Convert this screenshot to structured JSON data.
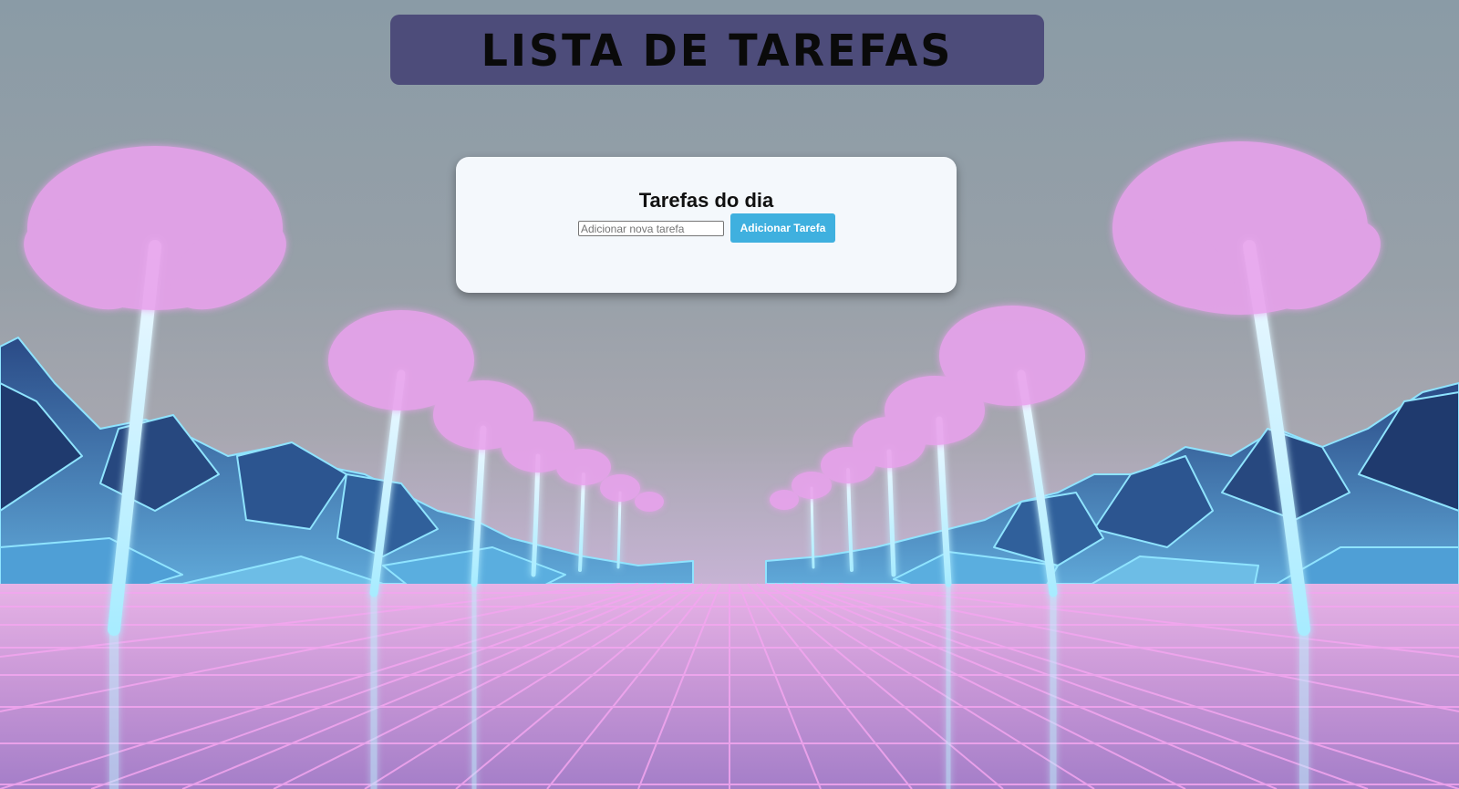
{
  "header": {
    "title": "LISTA DE TAREFAS"
  },
  "card": {
    "title": "Tarefas do dia",
    "input_placeholder": "Adicionar nova tarefa",
    "input_value": "",
    "add_button_label": "Adicionar Tarefa"
  },
  "colors": {
    "header_bg": "#4d4c7a",
    "card_bg": "#f4f8fc",
    "button_bg": "#3fb0df",
    "palm_pink": "#e6a0ea",
    "neon_cyan": "#9fe8ff",
    "mountain_blue": "#2d4f8a"
  }
}
